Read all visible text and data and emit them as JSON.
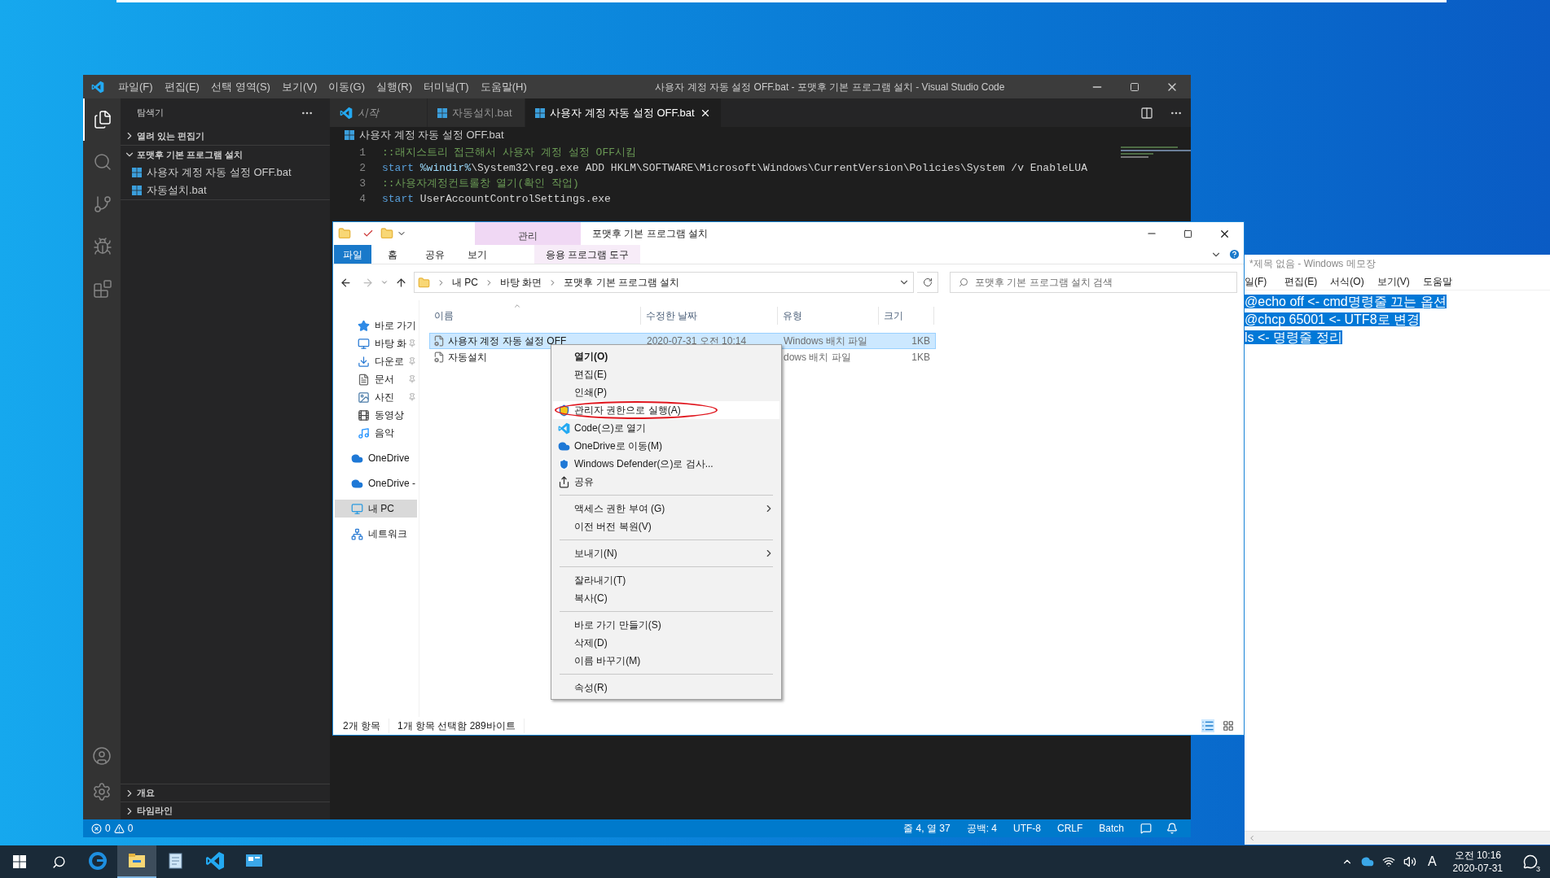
{
  "vscode": {
    "title": "사용자 계정 자동 설정 OFF.bat - 포맷후 기본 프로그램 설치 - Visual Studio Code",
    "menu": [
      "파일(F)",
      "편집(E)",
      "선택 영역(S)",
      "보기(V)",
      "이동(G)",
      "실행(R)",
      "터미널(T)",
      "도움말(H)"
    ],
    "activity": [
      {
        "kind": "files",
        "selected": true
      },
      {
        "kind": "search",
        "selected": false
      },
      {
        "kind": "source-control",
        "selected": false
      },
      {
        "kind": "run",
        "selected": false
      },
      {
        "kind": "extensions",
        "selected": false
      }
    ],
    "sidebar": {
      "title": "탐색기",
      "sections": [
        {
          "label": "열려 있는 편집기",
          "expanded": false
        },
        {
          "label": "포맷후 기본 프로그램 설치",
          "expanded": true,
          "files": [
            "사용자 계정 자동 설정 OFF.bat",
            "자동설치.bat"
          ]
        }
      ],
      "bottom_sections": [
        {
          "label": "개요",
          "expanded": false
        },
        {
          "label": "타임라인",
          "expanded": false
        }
      ]
    },
    "tabs": [
      {
        "label": "시작",
        "kind": "welcome",
        "selected": false
      },
      {
        "label": "자동설치.bat",
        "kind": "file",
        "selected": false
      },
      {
        "label": "사용자 계정 자동 설정 OFF.bat",
        "kind": "file",
        "selected": true
      }
    ],
    "breadcrumb": "사용자 계정 자동 설정 OFF.bat",
    "code_lines": [
      {
        "number": "1",
        "tokens": [
          {
            "kind": "comment",
            "text": "::래지스트리 접근해서 사용자 계정 설정 OFF시킴"
          }
        ]
      },
      {
        "number": "2",
        "tokens": [
          {
            "kind": "keyword",
            "text": "start "
          },
          {
            "kind": "variable",
            "text": "%windir%"
          },
          {
            "kind": "plain",
            "text": "\\System32\\reg.exe ADD HKLM\\SOFTWARE\\Microsoft\\Windows\\CurrentVersion\\Policies\\System /v EnableLUA"
          }
        ]
      },
      {
        "number": "3",
        "tokens": [
          {
            "kind": "comment",
            "text": "::사용자계정컨트롤창 열기(확인 작업)"
          }
        ]
      },
      {
        "number": "4",
        "tokens": [
          {
            "kind": "keyword",
            "text": "start"
          },
          {
            "kind": "plain",
            "text": " UserAccountControlSettings.exe"
          }
        ]
      }
    ],
    "status_bar": {
      "errors": "0",
      "warnings": "0",
      "items": [
        "줄 4, 열 37",
        "공백: 4",
        "UTF-8",
        "CRLF",
        "Batch"
      ]
    }
  },
  "explorer": {
    "title": "포맷후 기본 프로그램 설치",
    "context_group": "관리",
    "ribbon_tabs": [
      {
        "label": "파일",
        "kind": "file",
        "selected": false
      },
      {
        "label": "홈",
        "kind": "tab",
        "selected": false
      },
      {
        "label": "공유",
        "kind": "tab",
        "selected": false
      },
      {
        "label": "보기",
        "kind": "tab",
        "selected": false
      },
      {
        "label": "응용 프로그램 도구",
        "kind": "context",
        "selected": false
      }
    ],
    "path": [
      "내 PC",
      "바탕 화면",
      "포맷후 기본 프로그램 설치"
    ],
    "search": {
      "placeholder": "포맷후 기본 프로그램 설치 검색"
    },
    "nav": [
      {
        "label": "바로 가기",
        "kind": "star",
        "pinned": false,
        "selected": false,
        "group_start": false
      },
      {
        "label": "바탕 화",
        "kind": "desktop",
        "pinned": true,
        "selected": false,
        "group_start": false
      },
      {
        "label": "다운로",
        "kind": "download",
        "pinned": true,
        "selected": false,
        "group_start": false
      },
      {
        "label": "문서",
        "kind": "document",
        "pinned": true,
        "selected": false,
        "group_start": false
      },
      {
        "label": "사진",
        "kind": "picture",
        "pinned": true,
        "selected": false,
        "group_start": false
      },
      {
        "label": "동영상",
        "kind": "video",
        "pinned": false,
        "selected": false,
        "group_start": false
      },
      {
        "label": "음악",
        "kind": "music",
        "pinned": false,
        "selected": false,
        "group_start": false
      },
      {
        "label": "OneDrive",
        "kind": "cloud",
        "pinned": false,
        "selected": false,
        "group_start": true
      },
      {
        "label": "OneDrive -",
        "kind": "cloud",
        "pinned": false,
        "selected": false,
        "group_start": true
      },
      {
        "label": "내 PC",
        "kind": "pc",
        "pinned": false,
        "selected": true,
        "group_start": true
      },
      {
        "label": "네트워크",
        "kind": "network",
        "pinned": false,
        "selected": false,
        "group_start": true
      }
    ],
    "columns": [
      "이름",
      "수정한 날짜",
      "유형",
      "크기"
    ],
    "rows": [
      {
        "name": "사용자 계정 자동 설정 OFF",
        "date": "2020-07-31 오전 10:14",
        "type": "Windows 배치 파일",
        "size": "1KB",
        "selected": true
      },
      {
        "name": "자동설치",
        "type": "dows 배치 파일",
        "size": "1KB",
        "selected": false
      }
    ],
    "status": [
      "2개 항목",
      "1개 항목 선택함 289바이트"
    ]
  },
  "context_menu": [
    {
      "kind": "item",
      "label": "열기(O)",
      "bold": true,
      "highlighted": false,
      "submenu": false
    },
    {
      "kind": "item",
      "label": "편집(E)",
      "bold": false,
      "highlighted": false,
      "submenu": false
    },
    {
      "kind": "item",
      "label": "인쇄(P)",
      "bold": false,
      "highlighted": false,
      "submenu": false
    },
    {
      "kind": "shield",
      "label": "관리자 권한으로 실행(A)",
      "bold": false,
      "highlighted": true,
      "circled": true,
      "submenu": false
    },
    {
      "kind": "vscode",
      "label": "Code(으)로 열기",
      "bold": false,
      "highlighted": false,
      "submenu": false
    },
    {
      "kind": "cloud",
      "label": "OneDrive로 이동(M)",
      "bold": false,
      "highlighted": false,
      "submenu": false
    },
    {
      "kind": "defender",
      "label": "Windows Defender(으)로 검사...",
      "bold": false,
      "highlighted": false,
      "submenu": false
    },
    {
      "kind": "share",
      "label": "공유",
      "bold": false,
      "highlighted": false,
      "submenu": false
    },
    {
      "kind": "separator"
    },
    {
      "kind": "item",
      "label": "액세스 권한 부여 (G)",
      "bold": false,
      "highlighted": false,
      "submenu": true
    },
    {
      "kind": "item",
      "label": "이전 버전 복원(V)",
      "bold": false,
      "highlighted": false,
      "submenu": false
    },
    {
      "kind": "separator"
    },
    {
      "kind": "item",
      "label": "보내기(N)",
      "bold": false,
      "highlighted": false,
      "submenu": true
    },
    {
      "kind": "separator"
    },
    {
      "kind": "item",
      "label": "잘라내기(T)",
      "bold": false,
      "highlighted": false,
      "submenu": false
    },
    {
      "kind": "item",
      "label": "복사(C)",
      "bold": false,
      "highlighted": false,
      "submenu": false
    },
    {
      "kind": "separator"
    },
    {
      "kind": "item",
      "label": "바로 가기 만들기(S)",
      "bold": false,
      "highlighted": false,
      "submenu": false
    },
    {
      "kind": "item",
      "label": "삭제(D)",
      "bold": false,
      "highlighted": false,
      "submenu": false
    },
    {
      "kind": "item",
      "label": "이름 바꾸기(M)",
      "bold": false,
      "highlighted": false,
      "submenu": false
    },
    {
      "kind": "separator"
    },
    {
      "kind": "item",
      "label": "속성(R)",
      "bold": false,
      "highlighted": false,
      "submenu": false
    }
  ],
  "notepad": {
    "title": "*제목 없음 - Windows 메모장",
    "menu": [
      "일(F)",
      "편집(E)",
      "서식(O)",
      "보기(V)",
      "도움말"
    ],
    "lines": [
      {
        "text": "@echo off <- cmd명령줄 끄는 옵션",
        "selected": true
      },
      {
        "text": "@chcp 65001 <- UTF8로 변경",
        "selected": true
      },
      {
        "text": "ls <- 명령줄 정리",
        "selected": true
      }
    ]
  },
  "taskbar": {
    "apps": [
      {
        "kind": "edge",
        "selected": false
      },
      {
        "kind": "file-explorer",
        "selected": true
      },
      {
        "kind": "notepad",
        "selected": false
      },
      {
        "kind": "vscode",
        "selected": false
      },
      {
        "kind": "control-panel",
        "selected": false
      }
    ],
    "ime": "A",
    "time": "오전 10:16",
    "date": "2020-07-31",
    "notifications": "3"
  }
}
